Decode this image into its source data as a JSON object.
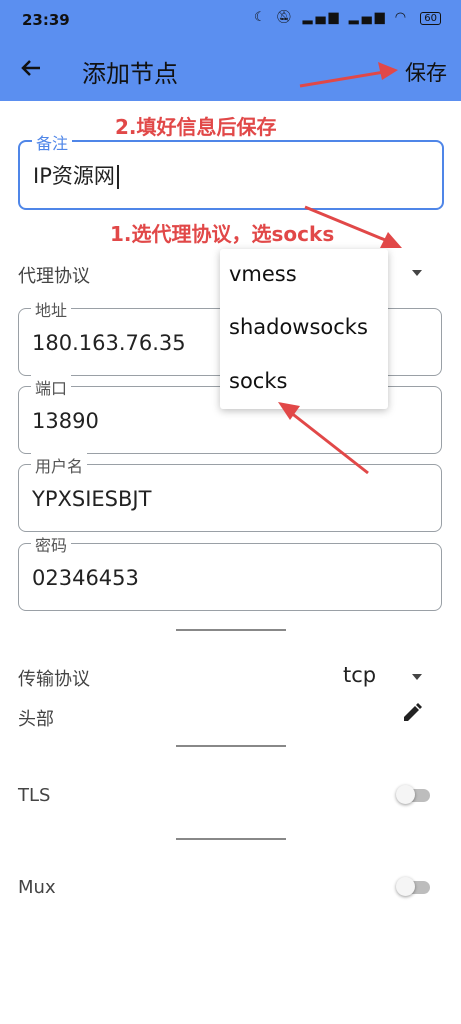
{
  "status": {
    "time": "23:39",
    "battery": "60"
  },
  "appbar": {
    "title": "添加节点",
    "save_label": "保存"
  },
  "annotations": {
    "step2": "2.填好信息后保存",
    "step1": "1.选代理协议，选socks"
  },
  "remarks": {
    "label": "备注",
    "value": "IP资源网"
  },
  "protocol": {
    "label": "代理协议"
  },
  "dropdown": {
    "options": [
      "vmess",
      "shadowsocks",
      "socks"
    ]
  },
  "address": {
    "label": "地址",
    "value": "180.163.76.35"
  },
  "port": {
    "label": "端口",
    "value": "13890"
  },
  "username": {
    "label": "用户名",
    "value": "YPXSIESBJT"
  },
  "password": {
    "label": "密码",
    "value": "02346453"
  },
  "transport": {
    "label": "传输协议",
    "value": "tcp"
  },
  "header": {
    "label": "头部"
  },
  "tls": {
    "label": "TLS"
  },
  "mux": {
    "label": "Mux"
  },
  "colors": {
    "appbar": "#5b8ff0",
    "accent": "#4f86e8",
    "annotation": "#e14848"
  }
}
